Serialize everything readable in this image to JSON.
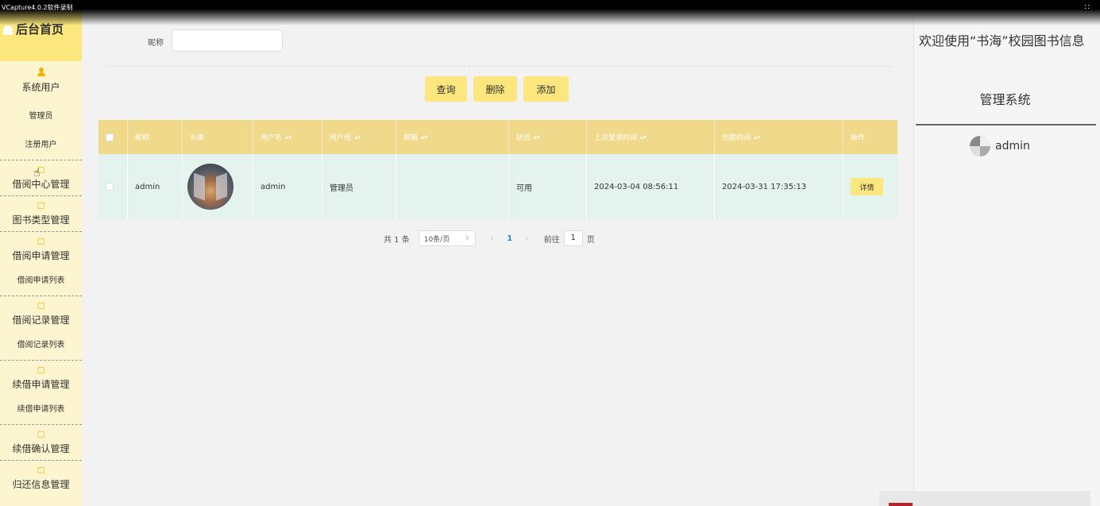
{
  "watermark": "VCapture4.0.2软件录制",
  "sidebar": {
    "home_label": "后台首页",
    "groups": [
      {
        "label": "系统用户",
        "subitems": [
          "管理员",
          "注册用户"
        ]
      },
      {
        "label": "借阅中心管理",
        "subitems": []
      },
      {
        "label": "图书类型管理",
        "subitems": []
      },
      {
        "label": "借阅申请管理",
        "subitems": [
          "借阅申请列表"
        ]
      },
      {
        "label": "借阅记录管理",
        "subitems": [
          "借阅记录列表"
        ]
      },
      {
        "label": "续借申请管理",
        "subitems": [
          "续借申请列表"
        ]
      },
      {
        "label": "续借确认管理",
        "subitems": []
      },
      {
        "label": "归还信息管理",
        "subitems": []
      }
    ]
  },
  "search": {
    "label": "昵称",
    "value": "",
    "placeholder": ""
  },
  "buttons": {
    "query": "查询",
    "delete": "删除",
    "add": "添加"
  },
  "table": {
    "columns": [
      "昵称",
      "头像",
      "用户名",
      "用户组",
      "邮箱",
      "状态",
      "上次登录时间",
      "创建时间",
      "操作"
    ],
    "rows": [
      {
        "nickname": "admin",
        "username": "admin",
        "group": "管理员",
        "email": "",
        "status": "可用",
        "last_login": "2024-03-04 08:56:11",
        "created": "2024-03-31 17:35:13",
        "action": "详情"
      }
    ]
  },
  "pagination": {
    "total": "共 1 条",
    "page_size": "10条/页",
    "current": "1",
    "goto_label": "前往",
    "goto_value": "1",
    "page_unit": "页"
  },
  "right_panel": {
    "welcome": "欢迎使用“书海”校园图书信息",
    "system": "管理系统",
    "user": "admin"
  },
  "colors": {
    "accent": "#fbe77d",
    "header": "#f0d98a",
    "sidebar_bg": "#fdf5cf",
    "row_bg": "#e5f3ef",
    "link": "#1e88e5"
  }
}
